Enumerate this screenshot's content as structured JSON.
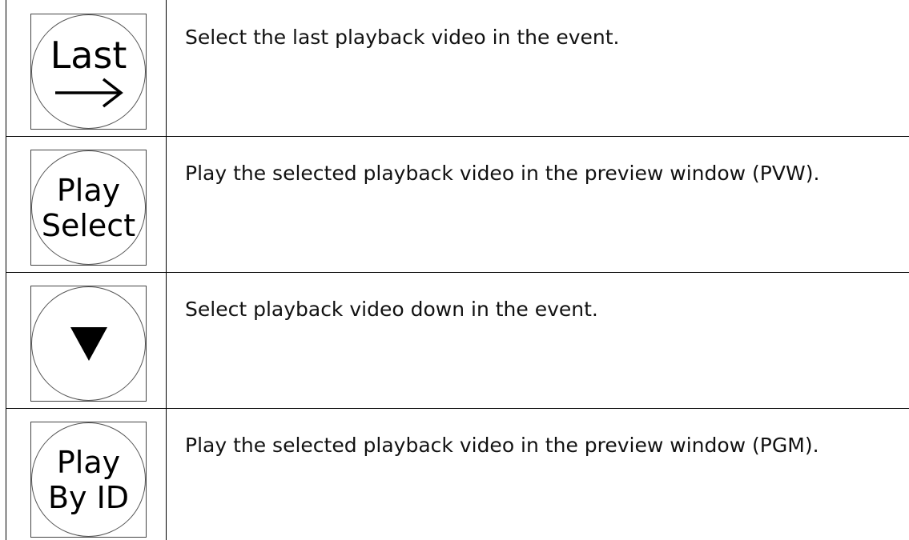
{
  "rows": [
    {
      "key_lines": [
        "Last"
      ],
      "key_symbol": "right-arrow",
      "description": "Select the last playback video in the event."
    },
    {
      "key_lines": [
        "Play",
        "Select"
      ],
      "key_symbol": "",
      "description": "Play the selected playback video in the preview window (PVW)."
    },
    {
      "key_lines": [],
      "key_symbol": "down-triangle",
      "description": "Select playback video down in the event."
    },
    {
      "key_lines": [
        "Play",
        "By ID"
      ],
      "key_symbol": "",
      "description": "Play the selected playback video in the preview window (PGM)."
    }
  ]
}
